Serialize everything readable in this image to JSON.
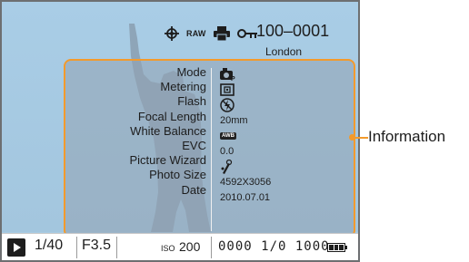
{
  "header": {
    "file_number": "100–0001",
    "location": "London",
    "icons": [
      {
        "name": "gps-icon"
      },
      {
        "name": "raw-icon",
        "text": "RAW"
      },
      {
        "name": "print-icon"
      },
      {
        "name": "protect-key-icon"
      }
    ]
  },
  "info_panel": {
    "labels": [
      "Mode",
      "Metering",
      "Flash",
      "Focal Length",
      "White Balance",
      "EVC",
      "Picture Wizard",
      "Photo Size",
      "Date"
    ],
    "values": {
      "mode_icon": "camera-program-icon",
      "metering_icon": "metering-icon",
      "flash_icon": "flash-off-icon",
      "focal_length": "20mm",
      "white_balance": "AWB",
      "evc": "0.0",
      "picture_wizard_icon": "picture-wizard-icon",
      "photo_size": "4592X3056",
      "date": "2010.07.01"
    }
  },
  "status_bar": {
    "play_icon": "playback-icon",
    "shutter": "1/40",
    "aperture": "F3.5",
    "iso_label": "ISO",
    "iso_value": "200",
    "counter": "0000 1/0 1000",
    "battery_icon": "battery-icon"
  },
  "callout": {
    "label": "Information",
    "color": "#f39a2c"
  },
  "colors": {
    "screen_background": "#a8cbe2",
    "highlight": "#f39a2c"
  }
}
